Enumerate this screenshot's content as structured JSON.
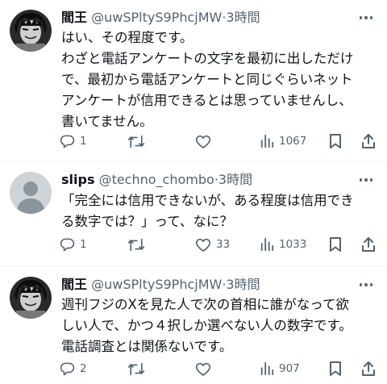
{
  "tweets": [
    {
      "name": "閻王",
      "handle": "@uwSPltyS9PhcjMW",
      "dot": "·",
      "time": "3時間",
      "lines": [
        "はい、その程度です。",
        "わざと電話アンケートの文字を最初に出しただけ",
        "で、最初から電話アンケートと同じぐらいネット",
        "アンケートが信用できるとは思っていませんし、",
        "書いてません。"
      ],
      "replies": "1",
      "retweets": "",
      "likes": "",
      "views": "1067"
    },
    {
      "name": "slips",
      "handle": "@techno_chombo",
      "dot": "·",
      "time": "3時間",
      "lines": [
        "「完全には信用できないが、ある程度は信用でき",
        "る数字では？」って、なに？"
      ],
      "replies": "1",
      "retweets": "",
      "likes": "33",
      "views": "1033"
    },
    {
      "name": "閻王",
      "handle": "@uwSPltyS9PhcjMW",
      "dot": "·",
      "time": "3時間",
      "lines": [
        "週刊フジのXを見た人で次の首相に誰がなって欲",
        "しい人で、かつ４択しか選べない人の数字です。",
        "電話調査とは関係ないです。"
      ],
      "replies": "2",
      "retweets": "",
      "likes": "",
      "views": "907"
    }
  ],
  "icons": [
    "reply-icon",
    "retweet-icon",
    "like-icon",
    "views-icon",
    "bookmark-icon",
    "share-icon",
    "more-icon"
  ],
  "colors": {
    "text": "#0f1419",
    "secondary": "#536471",
    "divider": "#eff3f4"
  }
}
